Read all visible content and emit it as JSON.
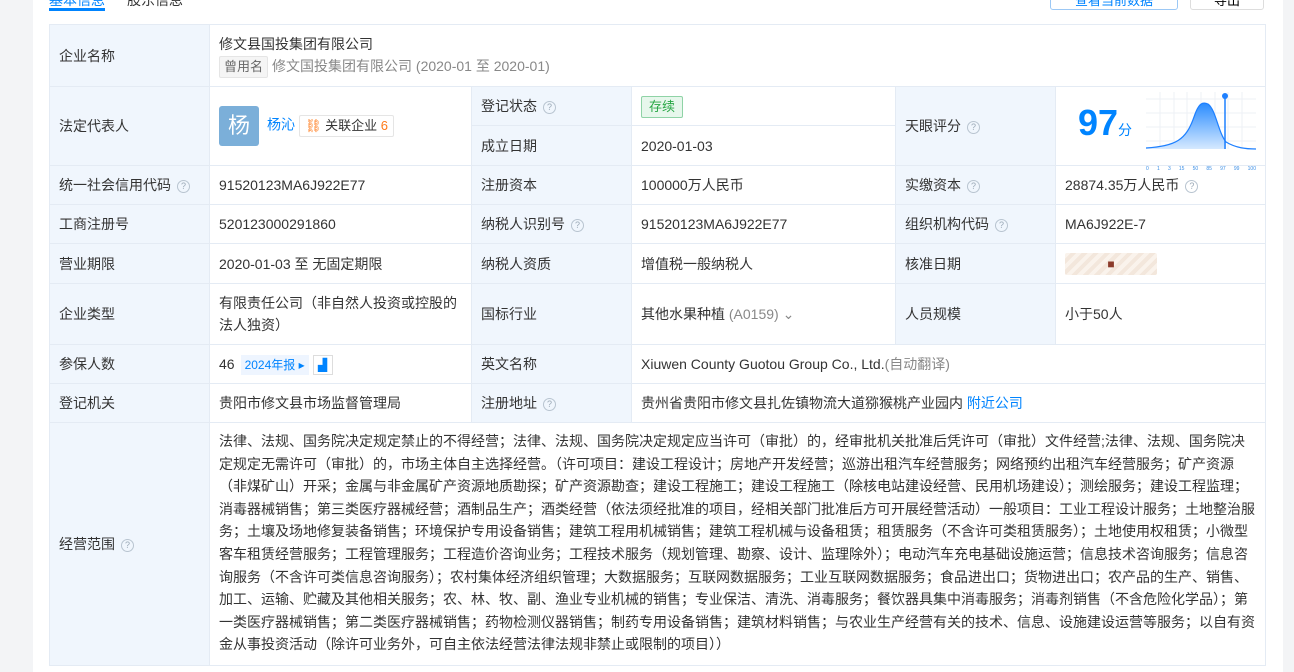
{
  "tabs": [
    "基本信息",
    "股东信息"
  ],
  "top_buttons": [
    "查看当前数据",
    "导出"
  ],
  "company": {
    "label": "企业名称",
    "name": "修文县国投集团有限公司",
    "former_tag": "曾用名",
    "former_name": "修文国投集团有限公司 (2020-01 至 2020-01)"
  },
  "legal_rep": {
    "label": "法定代表人",
    "avatar": "杨",
    "name": "杨沁",
    "related_label": "关联企业",
    "related_count": "6"
  },
  "reg_status": {
    "label": "登记状态",
    "value": "存续"
  },
  "founded": {
    "label": "成立日期",
    "value": "2020-01-03"
  },
  "rating": {
    "label": "天眼评分",
    "score": "97",
    "unit": "分",
    "ticks": [
      "0",
      "1",
      "3",
      "15",
      "50",
      "85",
      "97",
      "99",
      "100"
    ]
  },
  "credit_code": {
    "label": "统一社会信用代码",
    "value": "91520123MA6J922E77"
  },
  "reg_capital": {
    "label": "注册资本",
    "value": "100000万人民币"
  },
  "paid_capital": {
    "label": "实缴资本",
    "value": "28874.35万人民币"
  },
  "biz_reg_no": {
    "label": "工商注册号",
    "value": "520123000291860"
  },
  "taxpayer_id": {
    "label": "纳税人识别号",
    "value": "91520123MA6J922E77"
  },
  "org_code": {
    "label": "组织机构代码",
    "value": "MA6J922E-7"
  },
  "term": {
    "label": "营业期限",
    "value": "2020-01-03 至 无固定期限"
  },
  "taxpayer_qual": {
    "label": "纳税人资质",
    "value": "增值税一般纳税人"
  },
  "approval_date": {
    "label": "核准日期",
    "locked_icon": "lock-icon"
  },
  "company_type": {
    "label": "企业类型",
    "value": "有限责任公司（非自然人投资或控股的法人独资）"
  },
  "industry": {
    "label": "国标行业",
    "value": "其他水果种植",
    "code": "(A0159)"
  },
  "staff_size": {
    "label": "人员规模",
    "value": "小于50人"
  },
  "insured": {
    "label": "参保人数",
    "value": "46",
    "year": "2024年报"
  },
  "english_name": {
    "label": "英文名称",
    "value": "Xiuwen County Guotou Group Co., Ltd.",
    "note": "(自动翻译)"
  },
  "reg_authority": {
    "label": "登记机关",
    "value": "贵阳市修文县市场监督管理局"
  },
  "address": {
    "label": "注册地址",
    "value": "贵州省贵阳市修文县扎佐镇物流大道猕猴桃产业园内",
    "link": "附近公司"
  },
  "scope": {
    "label": "经营范围",
    "value": "法律、法规、国务院决定规定禁止的不得经营；法律、法规、国务院决定规定应当许可（审批）的，经审批机关批准后凭许可（审批）文件经营;法律、法规、国务院决定规定无需许可（审批）的，市场主体自主选择经营。（许可项目：建设工程设计；房地产开发经营；巡游出租汽车经营服务；网络预约出租汽车经营服务；矿产资源（非煤矿山）开采；金属与非金属矿产资源地质勘探；矿产资源勘查；建设工程施工；建设工程施工（除核电站建设经营、民用机场建设）；测绘服务；建设工程监理；消毒器械销售；第三类医疗器械经营；酒制品生产；酒类经营（依法须经批准的项目，经相关部门批准后方可开展经营活动）一般项目：工业工程设计服务；土地整治服务；土壤及场地修复装备销售；环境保护专用设备销售；建筑工程用机械销售；建筑工程机械与设备租赁；租赁服务（不含许可类租赁服务）；土地使用权租赁；小微型客车租赁经营服务；工程管理服务；工程造价咨询业务；工程技术服务（规划管理、勘察、设计、监理除外）；电动汽车充电基础设施运营；信息技术咨询服务；信息咨询服务（不含许可类信息咨询服务）；农村集体经济组织管理；大数据服务；互联网数据服务；工业互联网数据服务；食品进出口；货物进出口；农产品的生产、销售、加工、运输、贮藏及其他相关服务；农、林、牧、副、渔业专业机械的销售；专业保洁、清洗、消毒服务；餐饮器具集中消毒服务；消毒剂销售（不含危险化学品）；第一类医疗器械销售；第二类医疗器械销售；药物检测仪器销售；制药专用设备销售；建筑材料销售；与农业生产经营有关的技术、信息、设施建设运营等服务；以自有资金从事投资活动（除许可业务外，可自主依法经营法律法规非禁止或限制的项目））"
  }
}
